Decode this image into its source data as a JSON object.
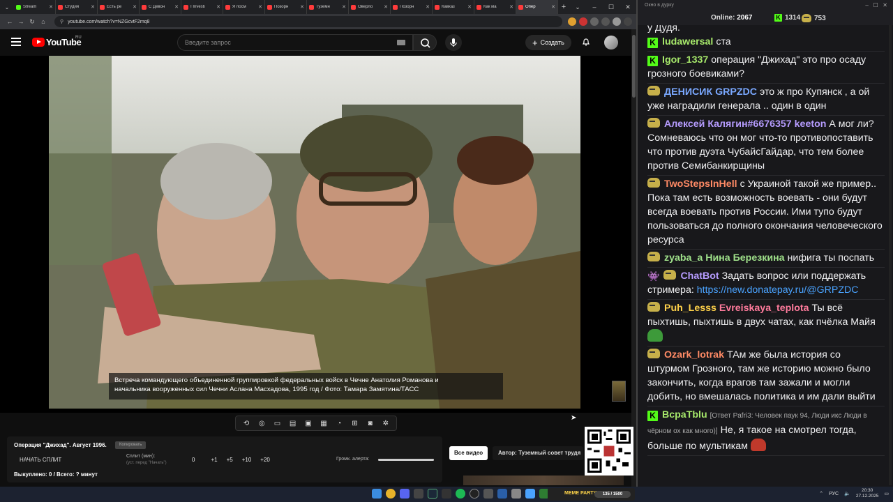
{
  "browser": {
    "tabs": [
      {
        "title": "Stream",
        "color": "#53fc18"
      },
      {
        "title": "Студия",
        "color": "#ff3b3b"
      },
      {
        "title": "Есть ре",
        "color": "#ff3b3b"
      },
      {
        "title": "С Девон",
        "color": "#ff3b3b"
      },
      {
        "title": "I Investi",
        "color": "#ff3b3b"
      },
      {
        "title": "Я посм",
        "color": "#ff3b3b"
      },
      {
        "title": "Позорн",
        "color": "#ff3b3b"
      },
      {
        "title": "Туземн",
        "color": "#ff3b3b"
      },
      {
        "title": "Оверло",
        "color": "#ff3b3b"
      },
      {
        "title": "Позорн",
        "color": "#ff3b3b"
      },
      {
        "title": "Кавказ",
        "color": "#ff3b3b"
      },
      {
        "title": "Как ма",
        "color": "#ff3b3b"
      },
      {
        "title": "Опер",
        "color": "#ff3b3b",
        "active": true
      }
    ],
    "url": "youtube.com/watch?v=NZGcvtF2mq8"
  },
  "youtube": {
    "logo_text": "YouTube",
    "region": "RU",
    "search_placeholder": "Введите запрос",
    "create_label": "Создать"
  },
  "video": {
    "caption_line1": "Встреча командующего объединенной группировкой федеральных войск в Чечне Анатолия Романова и",
    "caption_line2": "начальника вооруженных сил Чечни Аслана Масхадова, 1995 год / Фото: Тамара Замятина/ТАСС"
  },
  "panel": {
    "video_title": "Операция \"Джихад\". Август 1996.",
    "copy_label": "Копировать",
    "start_split": "НАЧАТЬ СПЛИТ",
    "split_label": "Сплит (мин):",
    "split_sub": "(уст. перед \"Начать\")",
    "split_values": [
      "0",
      "+1",
      "+5",
      "+10",
      "+20"
    ],
    "alert_volume_label": "Громк. алерта:",
    "alert_volume": 1.0,
    "bought": "Выкуплено: 0 / Всего: ? минут",
    "all_videos": "Все видео",
    "author": "Автор: Туземный совет трудя"
  },
  "chat": {
    "window_title": "Окно в дурку",
    "online_label": "Online:",
    "online": "2067",
    "kick_count": "1314",
    "peepo_count": "753",
    "first_line": "у Дудя.",
    "messages": [
      {
        "badge": "kick",
        "user": "ludawersal",
        "color": "#a7e96b",
        "text": "ста"
      },
      {
        "badge": "kick",
        "user": "Igor_1337",
        "color": "#a7e96b",
        "text": "операция \"Джихад\" это про осаду грозного боевиками?"
      },
      {
        "badge": "peepo",
        "user": "ДЕНИСИК",
        "color": "#7aa8ff",
        "mention": "GRPZDC",
        "mention_color": "#7aa8ff",
        "text": "это ж про Купянск , а ой уже наградили генерала .. один в один"
      },
      {
        "badge": "peepo",
        "user": "Алексей Калягин#6676357",
        "color": "#b69cff",
        "mention": "keeton",
        "mention_color": "#b69cff",
        "text": "А мог ли? Сомневаюсь что он мог что-то противопоставить что против дуэта ЧубайсГайдар, что тем более против Семибанкирщины"
      },
      {
        "badge": "peepo",
        "user": "TwoStepsInHell",
        "color": "#ff8a65",
        "text": "с Украиной такой же пример.. Пока там есть возможность воевать - они будут всегда воевать против России. Ими тупо будут пользоваться до полного окончания человеческого ресурса"
      },
      {
        "badge": "peepo",
        "user": "zyaba_a",
        "color": "#9fe08a",
        "mention": "Нина Березкина",
        "mention_color": "#9fe08a",
        "text": "нифига ты поспать"
      },
      {
        "badge": "bot",
        "user": "ChatBot",
        "color": "#b69cff",
        "text": "Задать вопрос или поддержать стримера:",
        "link": "https://new.donatepay.ru/@GRPZDC"
      },
      {
        "badge": "peepo",
        "user": "Puh_Lesss",
        "color": "#ffd24a",
        "mention": "Evreiskaya_teplota",
        "mention_color": "#ff7b9c",
        "text": "Ты всё пыхтишь, пыхтишь в двух чатах, как пчёлка Майя",
        "emote": "frog"
      },
      {
        "badge": "peepo",
        "user": "Ozark_lotrak",
        "color": "#ff8a65",
        "text": "ТАм же была история со штурмом Грозного, там же историю можно было закончить, когда врагов там зажали и могли добить, но вмешалась политика и им дали выйти"
      },
      {
        "badge": "kick",
        "user": "BcpaTblu",
        "color": "#a7e96b",
        "reply": "[Ответ Pafri3: Человек паук 94, Люди икс Люди в чёрном ох как много)]",
        "text": "Не, я такое на смотрел тогда, больше по мультикам",
        "emote": "frog-red"
      }
    ]
  },
  "taskbar": {
    "meme_party": "MEME PARTY",
    "meme_count": "135 / 1500",
    "lang": "РУС",
    "time": "20:30",
    "date": "27.12.2025"
  }
}
